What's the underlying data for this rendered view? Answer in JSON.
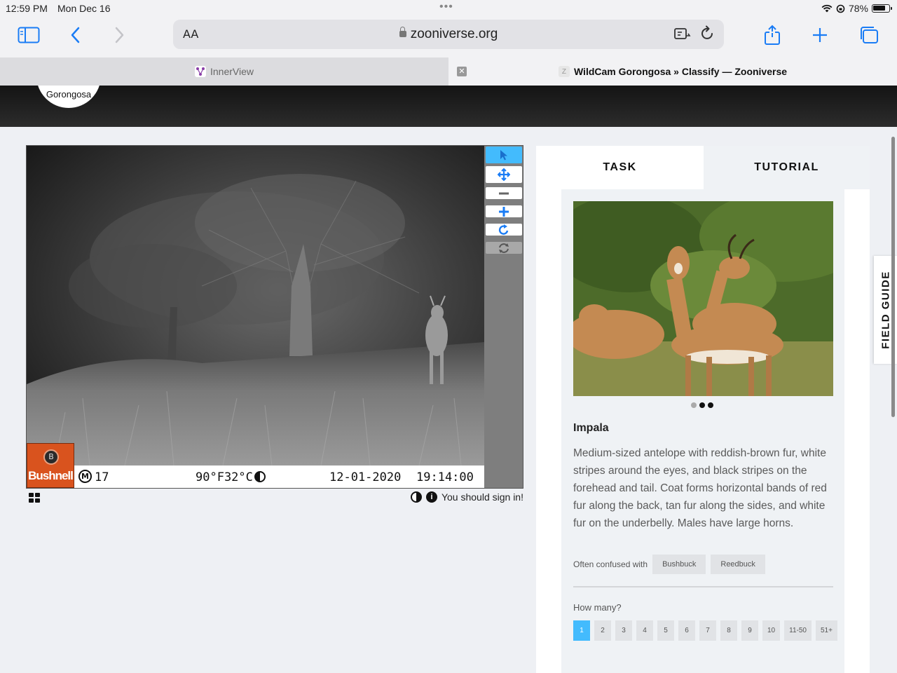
{
  "status_bar": {
    "time": "12:59 PM",
    "date": "Mon Dec 16",
    "battery": "78%"
  },
  "browser": {
    "text_size_label": "AA",
    "url": "zooniverse.org",
    "accent_color": "#1a7cf5",
    "tabs": [
      {
        "title": "InnerView",
        "active": false
      },
      {
        "title": "WildCam Gorongosa » Classify — Zooniverse",
        "active": true
      }
    ]
  },
  "site": {
    "logo_text": "Gorongosa"
  },
  "camera_stamp": {
    "brand": "Bushnell",
    "badge": "B",
    "camera_mode": "M",
    "camera_number": "17",
    "temperature": "90°F32°C",
    "date": "12-01-2020",
    "time": "19:14:00"
  },
  "viewer": {
    "sign_in_note": "You should sign in!"
  },
  "task_panel": {
    "tabs": [
      "TASK",
      "TUTORIAL"
    ],
    "species": {
      "name": "Impala",
      "description": "Medium-sized antelope with reddish-brown fur, white stripes around the eyes, and black stripes on the forehead and tail. Coat forms horizontal bands of red fur along the back, tan fur along the sides, and white fur on the underbelly. Males have large horns.",
      "confused_label": "Often confused with",
      "confused_with": [
        "Bushbuck",
        "Reedbuck"
      ],
      "carousel_active": 2
    },
    "how_many": {
      "label": "How many?",
      "options": [
        "1",
        "2",
        "3",
        "4",
        "5",
        "6",
        "7",
        "8",
        "9",
        "10",
        "11-50",
        "51+"
      ],
      "selected": "1"
    },
    "highlight_color": "#43bbfd"
  },
  "field_guide": {
    "label": "FIELD GUIDE"
  }
}
